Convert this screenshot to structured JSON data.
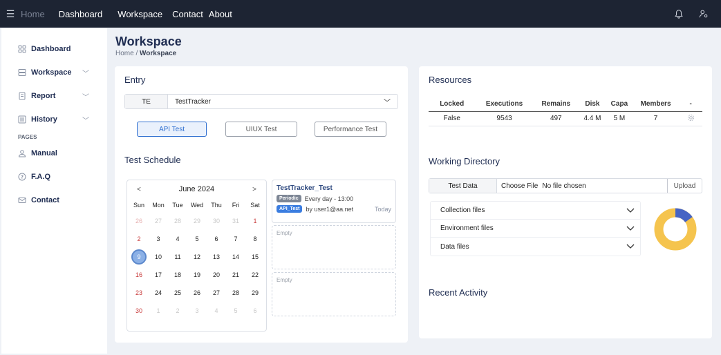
{
  "topbar": {
    "menu_icon": "hamburger-icon",
    "nav": [
      "Home",
      "Dashboard",
      "Workspace",
      "Contact",
      "About"
    ],
    "icons": [
      "bell-icon",
      "user-settings-icon"
    ]
  },
  "sidebar": {
    "items": [
      {
        "label": "Dashboard",
        "icon": "grid-icon"
      },
      {
        "label": "Workspace",
        "icon": "server-icon"
      },
      {
        "label": "Report",
        "icon": "document-icon"
      },
      {
        "label": "History",
        "icon": "list-icon"
      }
    ],
    "section": "PAGES",
    "pages": [
      {
        "label": "Manual",
        "icon": "user-icon"
      },
      {
        "label": "F.A.Q",
        "icon": "question-icon"
      },
      {
        "label": "Contact",
        "icon": "mail-icon"
      }
    ]
  },
  "header": {
    "title": "Workspace",
    "breadcrumb_home": "Home",
    "breadcrumb_sep": "/",
    "breadcrumb_current": "Workspace"
  },
  "entry": {
    "title": "Entry",
    "prefix": "TE",
    "value": "TestTracker",
    "buttons": [
      "API Test",
      "UIUX Test",
      "Performance Test"
    ],
    "active_button": "API Test"
  },
  "schedule": {
    "title": "Test Schedule",
    "calendar": {
      "month": "June 2024",
      "prev": "<",
      "next": ">",
      "day_names": [
        "Sun",
        "Mon",
        "Tue",
        "Wed",
        "Thu",
        "Fri",
        "Sat"
      ],
      "weeks": [
        [
          "26",
          "27",
          "28",
          "29",
          "30",
          "31",
          "1"
        ],
        [
          "2",
          "3",
          "4",
          "5",
          "6",
          "7",
          "8"
        ],
        [
          "9",
          "10",
          "11",
          "12",
          "13",
          "14",
          "15"
        ],
        [
          "16",
          "17",
          "18",
          "19",
          "20",
          "21",
          "22"
        ],
        [
          "23",
          "24",
          "25",
          "26",
          "27",
          "28",
          "29"
        ],
        [
          "30",
          "1",
          "2",
          "3",
          "4",
          "5",
          "6"
        ]
      ],
      "selected": "9"
    },
    "event": {
      "title": "TestTracker_Test",
      "badge1": "Periodic",
      "freq": "Every day - 13:00",
      "badge2": "API_Test",
      "by": "by user1@aa.net",
      "when": "Today"
    },
    "empty1": "Empty",
    "empty2": "Empty"
  },
  "resources": {
    "title": "Resources",
    "columns": [
      "Locked",
      "Executions",
      "Remains",
      "Disk",
      "Capa",
      "Members",
      "-"
    ],
    "row": [
      "False",
      "9543",
      "497",
      "4.4 M",
      "5 M",
      "7"
    ],
    "row_icon": "gear-icon"
  },
  "working_directory": {
    "title": "Working Directory",
    "label": "Test Data",
    "choose": "Choose File",
    "none": "No file chosen",
    "upload": "Upload",
    "accordion": [
      "Collection files",
      "Environment files",
      "Data files"
    ],
    "donut_colors": {
      "primary": "#f5c44e",
      "secondary": "#4664c4"
    },
    "donut_fraction": 0.15
  },
  "recent": {
    "title": "Recent Activity"
  }
}
